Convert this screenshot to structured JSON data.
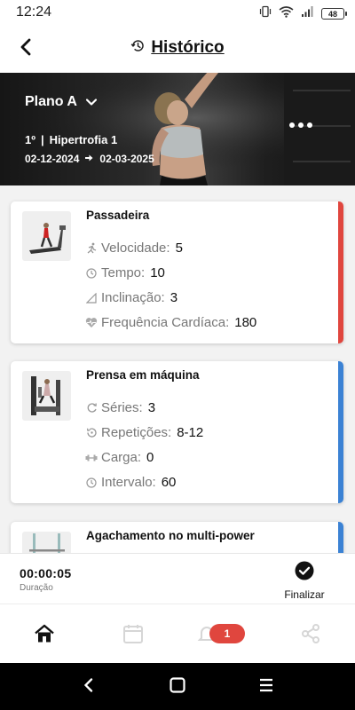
{
  "status_bar": {
    "time": "12:24",
    "battery": "48",
    "icons": [
      "vibrate-icon",
      "wifi-icon",
      "signal-icon",
      "battery-icon"
    ]
  },
  "header": {
    "title": "Histórico",
    "back_icon": "chevron-left-icon",
    "title_icon": "history-icon"
  },
  "banner": {
    "plan_name": "Plano A",
    "phase_number": "1º",
    "phase_separator": "|",
    "phase_name": "Hipertrofia 1",
    "start_date": "02-12-2024",
    "end_date": "02-03-2025",
    "menu_icon": "more-horizontal-icon"
  },
  "exercises": [
    {
      "name": "Passadeira",
      "accent": "#e0463e",
      "stats": [
        {
          "icon": "running-icon",
          "label": "Velocidade:",
          "value": "5"
        },
        {
          "icon": "clock-icon",
          "label": "Tempo:",
          "value": "10"
        },
        {
          "icon": "incline-icon",
          "label": "Inclinação:",
          "value": "3"
        },
        {
          "icon": "heartbeat-icon",
          "label": "Frequência Cardíaca:",
          "value": "180"
        }
      ]
    },
    {
      "name": "Prensa em máquina",
      "accent": "#3b82d4",
      "stats": [
        {
          "icon": "repeat-icon",
          "label": "Séries:",
          "value": "3"
        },
        {
          "icon": "counter-icon",
          "label": "Repetições:",
          "value": "8-12"
        },
        {
          "icon": "dumbbell-icon",
          "label": "Carga:",
          "value": "0"
        },
        {
          "icon": "clock-icon",
          "label": "Intervalo:",
          "value": "60"
        }
      ]
    },
    {
      "name": "Agachamento no multi-power",
      "accent": "#3b82d4",
      "stats": []
    }
  ],
  "session": {
    "timer": "00:00:05",
    "duration_label": "Duração",
    "finish_label": "Finalizar"
  },
  "bottom_nav": {
    "items": [
      "home-icon",
      "calendar-icon",
      "bell-icon",
      "share-icon"
    ],
    "notification_count": "1"
  },
  "colors": {
    "accent_red": "#e0463e",
    "accent_blue": "#3b82d4",
    "badge": "#e0463e"
  }
}
